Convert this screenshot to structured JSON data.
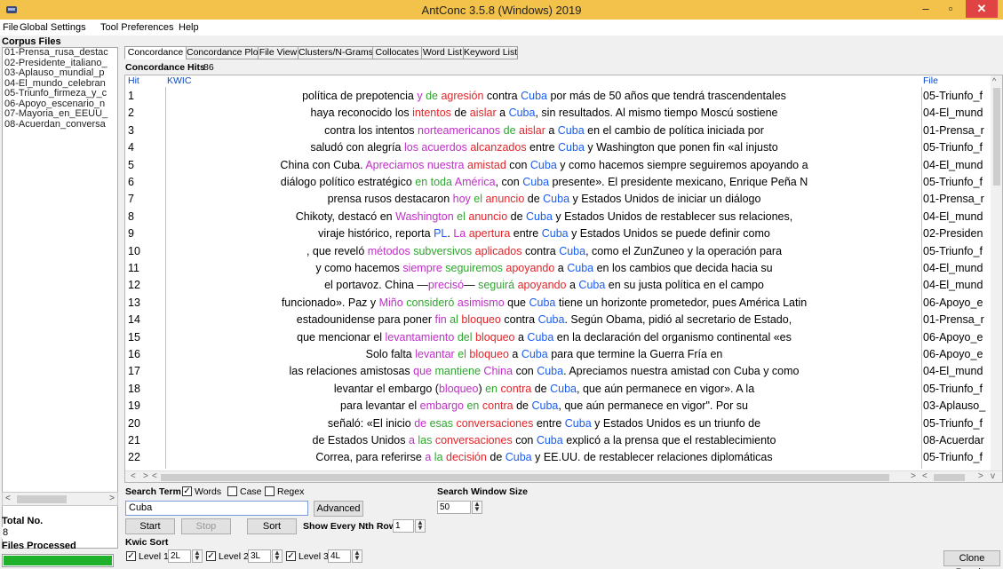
{
  "window": {
    "title": "AntConc 3.5.8 (Windows) 2019"
  },
  "menu": [
    "File",
    "Global Settings",
    "Tool Preferences",
    "Help"
  ],
  "corpus": {
    "header": "Corpus Files",
    "files": [
      "01-Prensa_rusa_destac",
      "02-Presidente_italiano_",
      "03-Aplauso_mundial_p",
      "04-El_mundo_celebran",
      "05-Triunfo_firmeza_y_c",
      "06-Apoyo_escenario_n",
      "07-Mayoria_en_EEUU_",
      "08-Acuerdan_conversa"
    ],
    "total_label": "Total No.",
    "total_value": "8",
    "processed_label": "Files Processed",
    "progress": 1.0,
    "progress_color": "#1fb02c"
  },
  "tabs": [
    "Concordance",
    "Concordance Plot",
    "File View",
    "Clusters/N-Grams",
    "Collocates",
    "Word List",
    "Keyword List"
  ],
  "hits": {
    "label": "Concordance Hits",
    "count": "86"
  },
  "columns": {
    "hit": "Hit",
    "kwic": "KWIC",
    "file": "File"
  },
  "rows": [
    {
      "num": "1",
      "file": "05-Triunfo_f",
      "segs": [
        [
          "política de prepotencia ",
          "k"
        ],
        [
          "y",
          "m"
        ],
        [
          " ",
          "k"
        ],
        [
          "de",
          "g"
        ],
        [
          " ",
          "k"
        ],
        [
          "agresión",
          "r"
        ],
        [
          " contra ",
          "k"
        ],
        [
          "Cuba",
          "b"
        ],
        [
          " por más de 50 años que tendrá trascendentales",
          "k"
        ]
      ]
    },
    {
      "num": "2",
      "file": "04-El_mund",
      "segs": [
        [
          "haya reconocido los ",
          "k"
        ],
        [
          "intentos",
          "r"
        ],
        [
          " de ",
          "k"
        ],
        [
          "aislar",
          "r"
        ],
        [
          " a ",
          "k"
        ],
        [
          "Cuba",
          "b"
        ],
        [
          ", sin resultados. Al mismo tiempo Moscú sostiene",
          "k"
        ]
      ]
    },
    {
      "num": "3",
      "file": "01-Prensa_r",
      "segs": [
        [
          "contra los intentos ",
          "k"
        ],
        [
          "norteamericanos",
          "m"
        ],
        [
          " de ",
          "g"
        ],
        [
          "aislar",
          "r"
        ],
        [
          " a ",
          "k"
        ],
        [
          "Cuba",
          "b"
        ],
        [
          " en el cambio de política iniciada por",
          "k"
        ]
      ]
    },
    {
      "num": "4",
      "file": "05-Triunfo_f",
      "segs": [
        [
          "saludó con alegría ",
          "k"
        ],
        [
          "los acuerdos",
          "m"
        ],
        [
          " ",
          "k"
        ],
        [
          "alcanzados",
          "r"
        ],
        [
          " entre ",
          "k"
        ],
        [
          "Cuba",
          "b"
        ],
        [
          " y Washington que ponen fin «al injusto",
          "k"
        ]
      ]
    },
    {
      "num": "5",
      "file": "04-El_mund",
      "segs": [
        [
          "China con Cuba. ",
          "k"
        ],
        [
          "Apreciamos",
          "m"
        ],
        [
          " ",
          "k"
        ],
        [
          "nuestra",
          "m"
        ],
        [
          " ",
          "k"
        ],
        [
          "amistad",
          "r"
        ],
        [
          " con ",
          "k"
        ],
        [
          "Cuba",
          "b"
        ],
        [
          " y como hacemos siempre seguiremos apoyando a",
          "k"
        ]
      ]
    },
    {
      "num": "6",
      "file": "05-Triunfo_f",
      "segs": [
        [
          "diálogo político estratégico ",
          "k"
        ],
        [
          "en toda",
          "g"
        ],
        [
          " ",
          "k"
        ],
        [
          "América",
          "m"
        ],
        [
          ", con ",
          "k"
        ],
        [
          "Cuba",
          "b"
        ],
        [
          " presente». El presidente mexicano, Enrique Peña N",
          "k"
        ]
      ]
    },
    {
      "num": "7",
      "file": "01-Prensa_r",
      "segs": [
        [
          "prensa rusos destacaron ",
          "k"
        ],
        [
          "hoy",
          "m"
        ],
        [
          " ",
          "k"
        ],
        [
          "el",
          "g"
        ],
        [
          " ",
          "k"
        ],
        [
          "anuncio",
          "r"
        ],
        [
          " de ",
          "k"
        ],
        [
          "Cuba",
          "b"
        ],
        [
          " y Estados Unidos de iniciar un diálogo",
          "k"
        ]
      ]
    },
    {
      "num": "8",
      "file": "04-El_mund",
      "segs": [
        [
          "Chikoty, destacó en ",
          "k"
        ],
        [
          "Washington",
          "m"
        ],
        [
          " ",
          "k"
        ],
        [
          "el",
          "g"
        ],
        [
          " ",
          "k"
        ],
        [
          "anuncio",
          "r"
        ],
        [
          " de ",
          "k"
        ],
        [
          "Cuba",
          "b"
        ],
        [
          " y Estados Unidos de restablecer sus relaciones,",
          "k"
        ]
      ]
    },
    {
      "num": "9",
      "file": "02-Presiden",
      "segs": [
        [
          "viraje histórico, reporta ",
          "k"
        ],
        [
          "PL",
          "b"
        ],
        [
          ". ",
          "k"
        ],
        [
          "La",
          "m"
        ],
        [
          " ",
          "k"
        ],
        [
          "apertura",
          "r"
        ],
        [
          " entre ",
          "k"
        ],
        [
          "Cuba",
          "b"
        ],
        [
          " y Estados Unidos se puede definir como",
          "k"
        ]
      ]
    },
    {
      "num": "10",
      "file": "05-Triunfo_f",
      "segs": [
        [
          ", que reveló ",
          "k"
        ],
        [
          "métodos",
          "m"
        ],
        [
          " ",
          "k"
        ],
        [
          "subversivos",
          "g"
        ],
        [
          " ",
          "k"
        ],
        [
          "aplicados",
          "r"
        ],
        [
          " contra ",
          "k"
        ],
        [
          "Cuba",
          "b"
        ],
        [
          ", como el ZunZuneo y la operación para",
          "k"
        ]
      ]
    },
    {
      "num": "11",
      "file": "04-El_mund",
      "segs": [
        [
          "y como hacemos ",
          "k"
        ],
        [
          "siempre",
          "m"
        ],
        [
          " ",
          "k"
        ],
        [
          "seguiremos",
          "g"
        ],
        [
          " ",
          "k"
        ],
        [
          "apoyando",
          "r"
        ],
        [
          " a ",
          "k"
        ],
        [
          "Cuba",
          "b"
        ],
        [
          " en los cambios que decida hacia su",
          "k"
        ]
      ]
    },
    {
      "num": "12",
      "file": "04-El_mund",
      "segs": [
        [
          "el portavoz. China —",
          "k"
        ],
        [
          "precisó",
          "m"
        ],
        [
          "— ",
          "k"
        ],
        [
          "seguirá",
          "g"
        ],
        [
          " ",
          "k"
        ],
        [
          "apoyando",
          "r"
        ],
        [
          " a ",
          "k"
        ],
        [
          "Cuba",
          "b"
        ],
        [
          " en su justa política en el campo",
          "k"
        ]
      ]
    },
    {
      "num": "13",
      "file": "06-Apoyo_e",
      "segs": [
        [
          "funcionado». Paz y ",
          "k"
        ],
        [
          "Miño",
          "m"
        ],
        [
          " ",
          "k"
        ],
        [
          "consideró",
          "g"
        ],
        [
          " ",
          "k"
        ],
        [
          "asimismo",
          "m"
        ],
        [
          " que ",
          "k"
        ],
        [
          "Cuba",
          "b"
        ],
        [
          " tiene un horizonte prometedor, pues América Latin",
          "k"
        ]
      ]
    },
    {
      "num": "14",
      "file": "01-Prensa_r",
      "segs": [
        [
          "estadounidense para poner ",
          "k"
        ],
        [
          "fin",
          "m"
        ],
        [
          " ",
          "k"
        ],
        [
          "al",
          "g"
        ],
        [
          " ",
          "k"
        ],
        [
          "bloqueo",
          "r"
        ],
        [
          " contra ",
          "k"
        ],
        [
          "Cuba",
          "b"
        ],
        [
          ". Según Obama, pidió al secretario de Estado,",
          "k"
        ]
      ]
    },
    {
      "num": "15",
      "file": "06-Apoyo_e",
      "segs": [
        [
          "que mencionar el ",
          "k"
        ],
        [
          "levantamiento",
          "m"
        ],
        [
          " ",
          "k"
        ],
        [
          "del",
          "g"
        ],
        [
          " ",
          "k"
        ],
        [
          "bloqueo",
          "r"
        ],
        [
          " a ",
          "k"
        ],
        [
          "Cuba",
          "b"
        ],
        [
          " en la declaración del organismo continental «es",
          "k"
        ]
      ]
    },
    {
      "num": "16",
      "file": "06-Apoyo_e",
      "segs": [
        [
          "Solo falta ",
          "k"
        ],
        [
          "levantar",
          "m"
        ],
        [
          " ",
          "k"
        ],
        [
          "el",
          "g"
        ],
        [
          " ",
          "k"
        ],
        [
          "bloqueo",
          "r"
        ],
        [
          " a ",
          "k"
        ],
        [
          "Cuba",
          "b"
        ],
        [
          " para que termine la Guerra Fría en",
          "k"
        ]
      ]
    },
    {
      "num": "17",
      "file": "04-El_mund",
      "segs": [
        [
          "las relaciones amistosas ",
          "k"
        ],
        [
          "que",
          "m"
        ],
        [
          " ",
          "k"
        ],
        [
          "mantiene",
          "g"
        ],
        [
          " ",
          "k"
        ],
        [
          "China",
          "m"
        ],
        [
          " con ",
          "k"
        ],
        [
          "Cuba",
          "b"
        ],
        [
          ". Apreciamos nuestra amistad con Cuba y como",
          "k"
        ]
      ]
    },
    {
      "num": "18",
      "file": "05-Triunfo_f",
      "segs": [
        [
          "levantar el embargo (",
          "k"
        ],
        [
          "bloqueo",
          "m"
        ],
        [
          ") ",
          "k"
        ],
        [
          "en",
          "g"
        ],
        [
          " ",
          "k"
        ],
        [
          "contra",
          "r"
        ],
        [
          " de ",
          "k"
        ],
        [
          "Cuba",
          "b"
        ],
        [
          ", que aún permanece en vigor». A la",
          "k"
        ]
      ]
    },
    {
      "num": "19",
      "file": "03-Aplauso_",
      "segs": [
        [
          "para levantar el ",
          "k"
        ],
        [
          "embargo",
          "m"
        ],
        [
          " ",
          "k"
        ],
        [
          "en",
          "g"
        ],
        [
          " ",
          "k"
        ],
        [
          "contra",
          "r"
        ],
        [
          " de ",
          "k"
        ],
        [
          "Cuba",
          "b"
        ],
        [
          ", que aún permanece en vigor\". Por su",
          "k"
        ]
      ]
    },
    {
      "num": "20",
      "file": "05-Triunfo_f",
      "segs": [
        [
          "señaló: «El inicio ",
          "k"
        ],
        [
          "de",
          "m"
        ],
        [
          " ",
          "k"
        ],
        [
          "esas",
          "g"
        ],
        [
          " ",
          "k"
        ],
        [
          "conversaciones",
          "r"
        ],
        [
          " entre ",
          "k"
        ],
        [
          "Cuba",
          "b"
        ],
        [
          " y Estados Unidos es un triunfo de",
          "k"
        ]
      ]
    },
    {
      "num": "21",
      "file": "08-Acuerdar",
      "segs": [
        [
          "de Estados Unidos ",
          "k"
        ],
        [
          "a",
          "m"
        ],
        [
          " ",
          "k"
        ],
        [
          "las",
          "g"
        ],
        [
          " ",
          "k"
        ],
        [
          "conversaciones",
          "r"
        ],
        [
          " con ",
          "k"
        ],
        [
          "Cuba",
          "b"
        ],
        [
          " explicó a la prensa que el restablecimiento",
          "k"
        ]
      ]
    },
    {
      "num": "22",
      "file": "05-Triunfo_f",
      "segs": [
        [
          "Correa, para referirse ",
          "k"
        ],
        [
          "a",
          "m"
        ],
        [
          " ",
          "k"
        ],
        [
          "la",
          "g"
        ],
        [
          " ",
          "k"
        ],
        [
          "decisión",
          "r"
        ],
        [
          " de ",
          "k"
        ],
        [
          "Cuba",
          "b"
        ],
        [
          " y EE.UU. de restablecer relaciones diplomáticas",
          "k"
        ]
      ]
    }
  ],
  "search": {
    "term_label": "Search Term",
    "words_label": "Words",
    "words_checked": true,
    "case_label": "Case",
    "case_checked": false,
    "regex_label": "Regex",
    "regex_checked": false,
    "value": "Cuba",
    "advanced_label": "Advanced",
    "window_label": "Search Window Size",
    "window_value": "50"
  },
  "buttons": {
    "start": "Start",
    "stop": "Stop",
    "sort": "Sort",
    "clone": "Clone Results"
  },
  "nth": {
    "label": "Show Every Nth Row",
    "value": "1"
  },
  "kwic_sort": {
    "label": "Kwic Sort",
    "levels": [
      {
        "label": "Level 1",
        "value": "2L",
        "checked": true
      },
      {
        "label": "Level 2",
        "value": "3L",
        "checked": true
      },
      {
        "label": "Level 3",
        "value": "4L",
        "checked": true
      }
    ]
  },
  "colors": {
    "titlebar": "#f3c24a",
    "node": "#1a5cf0",
    "red": "#e0262b",
    "green": "#2fa62f",
    "magenta": "#c02fc8"
  }
}
